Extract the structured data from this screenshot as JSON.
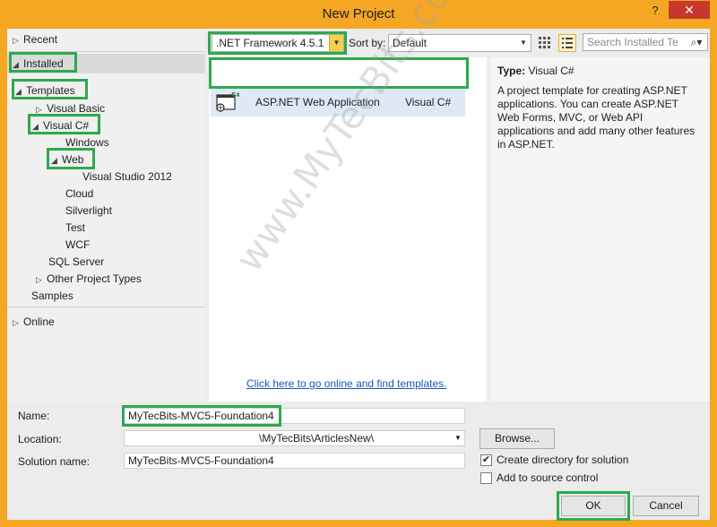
{
  "window": {
    "title": "New Project",
    "help_label": "?",
    "close_label": "✕"
  },
  "tree": {
    "recent": "Recent",
    "installed": "Installed",
    "templates": "Templates",
    "visual_basic": "Visual Basic",
    "visual_csharp": "Visual C#",
    "windows": "Windows",
    "web": "Web",
    "visual_studio_2012": "Visual Studio 2012",
    "cloud": "Cloud",
    "silverlight": "Silverlight",
    "test": "Test",
    "wcf": "WCF",
    "sql_server": "SQL Server",
    "other_project_types": "Other Project Types",
    "samples": "Samples",
    "online": "Online"
  },
  "toolbar": {
    "framework_value": ".NET Framework 4.5.1",
    "sort_label": "Sort by:",
    "sort_value": "Default",
    "search_placeholder": "Search Installed Te"
  },
  "templates_list": [
    {
      "name": "ASP.NET Web Application",
      "language": "Visual C#",
      "icon": "web-app-icon",
      "badge": "C#"
    }
  ],
  "center": {
    "online_link": "Click here to go online and find templates.",
    "watermark": "www.MyTecBits.com"
  },
  "details": {
    "type_label": "Type:",
    "type_value": "Visual C#",
    "description": "A project template for creating ASP.NET applications. You can create ASP.NET Web Forms, MVC,  or Web API applications and add many other features in ASP.NET."
  },
  "form": {
    "name_label": "Name:",
    "name_value": "MyTecBits-MVC5-Foundation4",
    "location_label": "Location:",
    "location_value": "\\MyTecBits\\ArticlesNew\\",
    "solution_label": "Solution name:",
    "solution_value": "MyTecBits-MVC5-Foundation4",
    "browse_label": "Browse...",
    "create_dir_label": "Create directory for solution",
    "create_dir_checked": true,
    "source_control_label": "Add to source control",
    "source_control_checked": false,
    "ok_label": "OK",
    "cancel_label": "Cancel"
  },
  "colors": {
    "titlebar": "#f5a623",
    "close": "#c7392c",
    "highlight_box": "#2fa84f",
    "link": "#1a56b8"
  }
}
